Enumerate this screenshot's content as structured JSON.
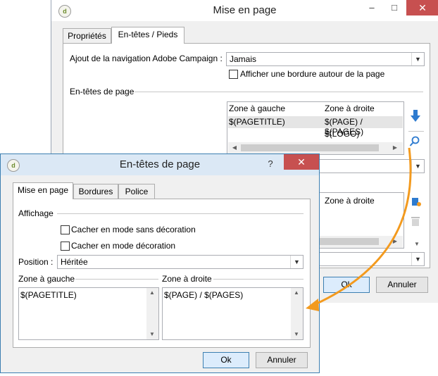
{
  "main_dialog": {
    "title": "Mise en page",
    "controls": {
      "minimize": "–",
      "maximize": "□",
      "close": "✕"
    },
    "tabs": [
      {
        "label": "Propriétés",
        "active": false
      },
      {
        "label": "En-têtes / Pieds",
        "active": true
      }
    ],
    "nav_label": "Ajout de la navigation Adobe Campaign :",
    "nav_value": "Jamais",
    "border_checkbox_label": "Afficher une bordure autour de la page",
    "headers_section": "En-têtes de page",
    "grid": {
      "col_left": "Zone à gauche",
      "col_right": "Zone à droite",
      "rows": [
        {
          "left": "$(PAGETITLE)",
          "right": "$(PAGE) / $(PAGES)"
        },
        {
          "left": "",
          "right": "$(LOGO)"
        }
      ]
    },
    "grid2_col_right": "Zone à droite",
    "ok_label": "Ok",
    "cancel_label": "Annuler"
  },
  "header_dialog": {
    "title": "En-têtes de page",
    "controls": {
      "help": "?",
      "close": "✕"
    },
    "tabs": [
      {
        "label": "Mise en page",
        "active": true
      },
      {
        "label": "Bordures",
        "active": false
      },
      {
        "label": "Police",
        "active": false
      }
    ],
    "display_section": "Affichage",
    "hide_no_decoration": "Cacher en mode sans décoration",
    "hide_decoration": "Cacher en mode décoration",
    "position_label": "Position :",
    "position_value": "Héritée",
    "left_zone_label": "Zone à gauche",
    "left_zone_value": "$(PAGETITLE)",
    "right_zone_label": "Zone à droite",
    "right_zone_value": "$(PAGE) / $(PAGES)",
    "ok_label": "Ok",
    "cancel_label": "Annuler"
  },
  "colors": {
    "arrow": "#f39a1e",
    "accent_blue": "#2e7bcf",
    "close_red": "#c75050"
  }
}
